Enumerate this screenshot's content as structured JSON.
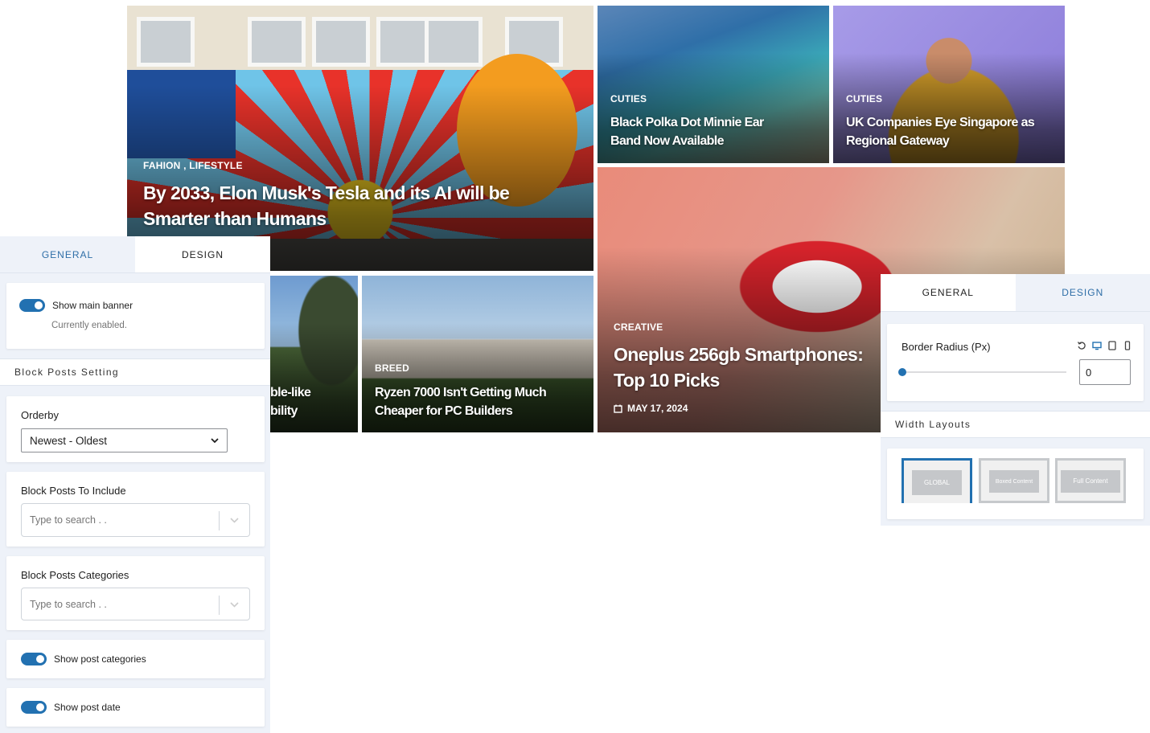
{
  "tiles": {
    "main": {
      "categories": [
        "FAHION",
        "LIFESTYLE"
      ],
      "category_sep": ",",
      "title": "By 2033, Elon Musk's Tesla and its AI will be Smarter than Humans"
    },
    "beach": {
      "category": "CUTIES",
      "title": "Black Polka Dot Minnie Ear Band Now Available"
    },
    "girl": {
      "category": "CUTIES",
      "title": "UK Companies Eye Singapore as Regional Gateway"
    },
    "pop": {
      "category": "CREATIVE",
      "title": "Oneplus 256gb Smartphones: Top 10 Picks",
      "date": "MAY 17, 2024"
    },
    "castle": {
      "category": "BREED",
      "title": "Ryzen 7000 Isn't Getting Much Cheaper for PC Builders"
    },
    "tree": {
      "title_line1": "ble-like",
      "title_line2": "bility"
    }
  },
  "left_panel": {
    "tabs": [
      {
        "label": "GENERAL",
        "active": true
      },
      {
        "label": "DESIGN",
        "active": false
      }
    ],
    "main_banner": {
      "label": "Show main banner",
      "status": "Currently enabled.",
      "enabled": true
    },
    "section_title": "Block Posts Setting",
    "orderby": {
      "label": "Orderby",
      "value": "Newest - Oldest"
    },
    "include": {
      "label": "Block Posts To Include",
      "placeholder": "Type to search . ."
    },
    "categories": {
      "label": "Block Posts Categories",
      "placeholder": "Type to search . ."
    },
    "show_categories": {
      "label": "Show post categories",
      "enabled": true
    },
    "show_date": {
      "label": "Show post date",
      "enabled": true
    }
  },
  "right_panel": {
    "tabs": [
      {
        "label": "GENERAL",
        "active": false
      },
      {
        "label": "DESIGN",
        "active": true
      }
    ],
    "border_radius": {
      "label": "Border Radius (Px)",
      "value": "0",
      "slider_fraction": 0
    },
    "section_title": "Width Layouts",
    "layouts": [
      {
        "label": "GLOBAL",
        "active": true
      },
      {
        "label": "Boxed Content",
        "active": false
      },
      {
        "label": "Full Content",
        "active": false
      }
    ]
  },
  "colors": {
    "accent": "#2271b1",
    "tab_active": "#2e6ea7",
    "panel_bg": "#eef2f9"
  },
  "icons": [
    "calendar-icon",
    "chevron-down-icon",
    "reset-icon",
    "desktop-icon",
    "tablet-icon",
    "mobile-icon"
  ]
}
